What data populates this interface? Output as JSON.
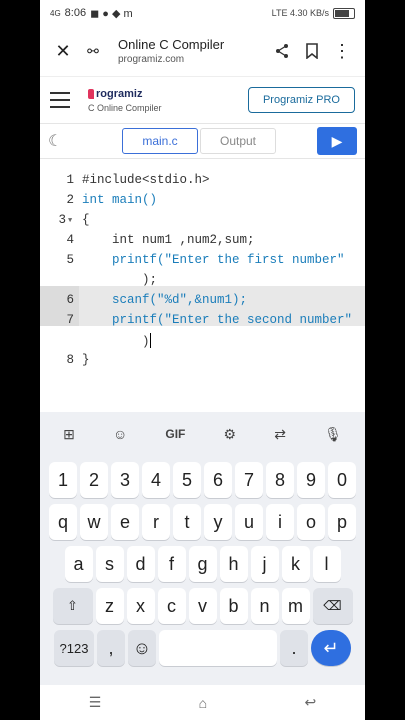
{
  "status": {
    "time": "8:06",
    "net": "4G",
    "right": "LTE 4.30 KB/s"
  },
  "browser": {
    "title": "Online C Compiler",
    "url": "programiz.com"
  },
  "site": {
    "brand": "rogramiz",
    "subtitle": "C Online Compiler",
    "pro_label": "Programiz PRO"
  },
  "tabs": {
    "file": "main.c",
    "output": "Output"
  },
  "editor": {
    "lines": [
      {
        "n": "1",
        "t": "#include<stdio.h>"
      },
      {
        "n": "2",
        "t": "int main()"
      },
      {
        "n": "3",
        "t": "{"
      },
      {
        "n": "4",
        "t": "    int num1 ,num2,sum;"
      },
      {
        "n": "5",
        "t": "    printf(\"Enter the first number\""
      },
      {
        "n": "",
        "t": "        );"
      },
      {
        "n": "6",
        "t": "    scanf(\"%d\",&num1);"
      },
      {
        "n": "7",
        "t": "    printf(\"Enter the second number\""
      },
      {
        "n": "",
        "t": "        )"
      },
      {
        "n": "8",
        "t": "}"
      }
    ]
  },
  "keyboard": {
    "tools": [
      "grid-icon",
      "sticker-icon",
      "GIF",
      "gear-icon",
      "translate-icon",
      "mic-icon"
    ],
    "gif": "GIF",
    "row_num": [
      "1",
      "2",
      "3",
      "4",
      "5",
      "6",
      "7",
      "8",
      "9",
      "0"
    ],
    "row1": [
      "q",
      "w",
      "e",
      "r",
      "t",
      "y",
      "u",
      "i",
      "o",
      "p"
    ],
    "row2": [
      "a",
      "s",
      "d",
      "f",
      "g",
      "h",
      "j",
      "k",
      "l"
    ],
    "row3": [
      "z",
      "x",
      "c",
      "v",
      "b",
      "n",
      "m"
    ],
    "sym": "?123",
    "comma": ",",
    "period": "."
  }
}
